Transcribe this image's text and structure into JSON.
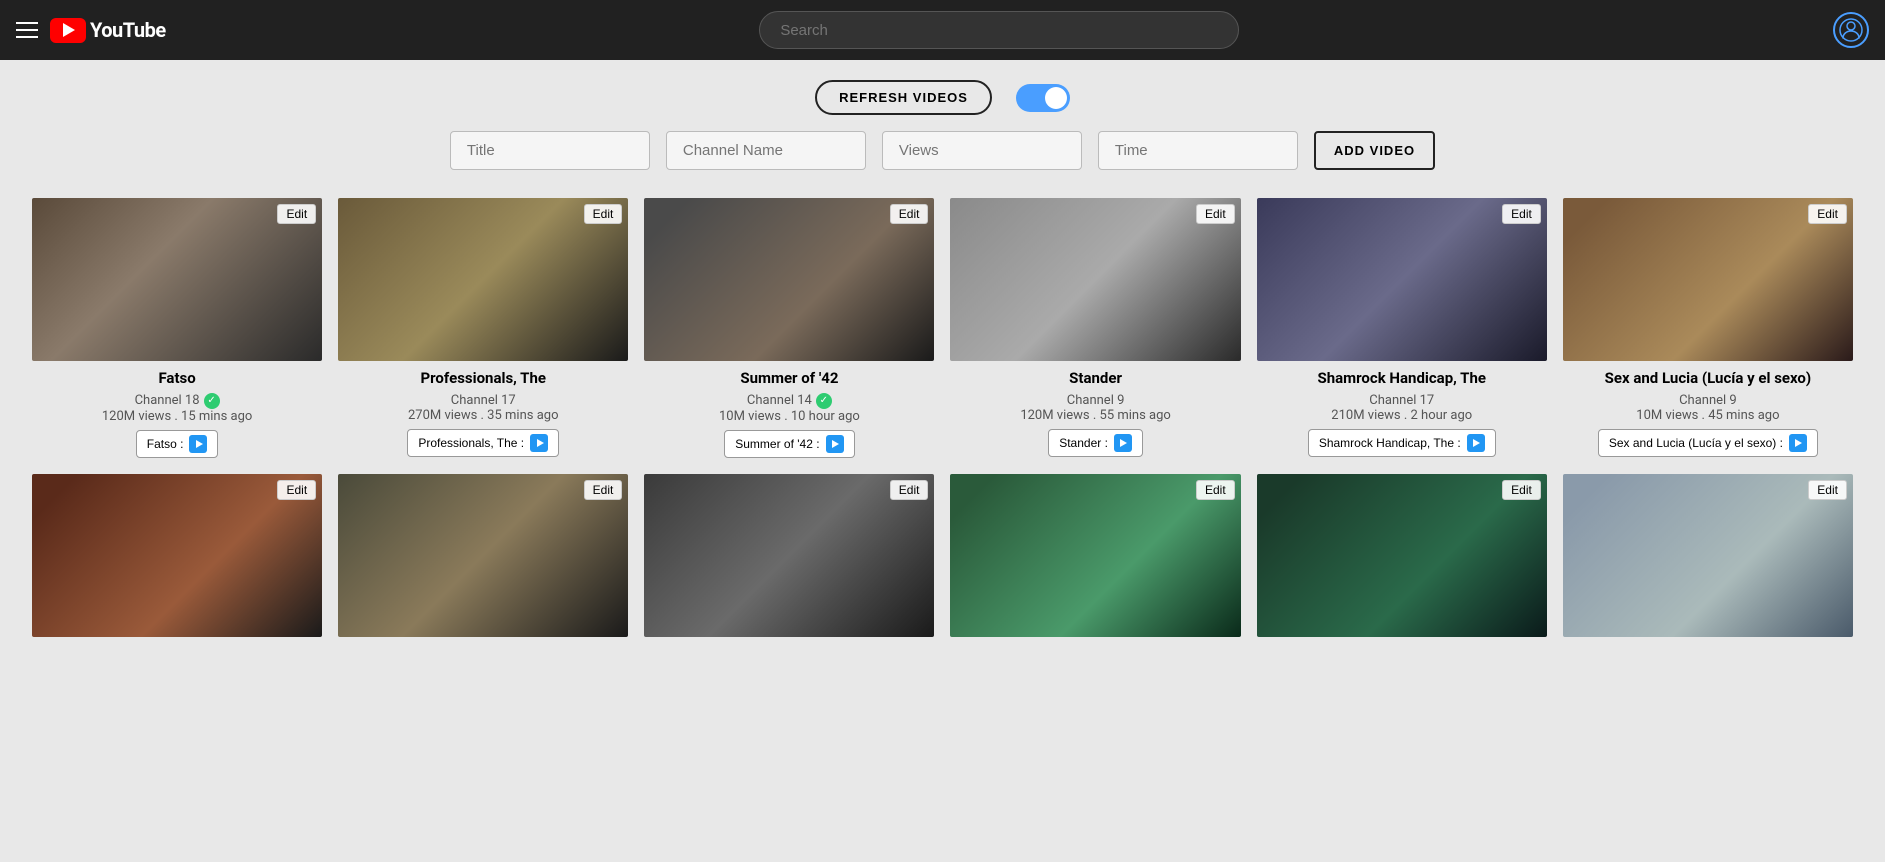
{
  "header": {
    "title": "YouTube",
    "search_placeholder": "Search",
    "hamburger_label": "Menu"
  },
  "controls": {
    "refresh_label": "REFRESH VIDEOS",
    "toggle_checked": true
  },
  "filters": {
    "title_placeholder": "Title",
    "channel_placeholder": "Channel Name",
    "views_placeholder": "Views",
    "time_placeholder": "Time",
    "add_button_label": "ADD VIDEO"
  },
  "videos": [
    {
      "id": 1,
      "title": "Fatso",
      "channel": "Channel 18",
      "verified": true,
      "views": "120M views",
      "time": "15 mins ago",
      "link_label": "Fatso :",
      "thumb_class": "thumb-1"
    },
    {
      "id": 2,
      "title": "Professionals, The",
      "channel": "Channel 17",
      "verified": false,
      "views": "270M views",
      "time": "35 mins ago",
      "link_label": "Professionals, The :",
      "thumb_class": "thumb-2"
    },
    {
      "id": 3,
      "title": "Summer of '42",
      "channel": "Channel 14",
      "verified": true,
      "views": "10M views",
      "time": "10 hour ago",
      "link_label": "Summer of '42 :",
      "thumb_class": "thumb-3"
    },
    {
      "id": 4,
      "title": "Stander",
      "channel": "Channel 9",
      "verified": false,
      "views": "120M views",
      "time": "55 mins ago",
      "link_label": "Stander :",
      "thumb_class": "thumb-4"
    },
    {
      "id": 5,
      "title": "Shamrock Handicap, The",
      "channel": "Channel 17",
      "verified": false,
      "views": "210M views",
      "time": "2 hour ago",
      "link_label": "Shamrock Handicap, The :",
      "thumb_class": "thumb-5"
    },
    {
      "id": 6,
      "title": "Sex and Lucia (Lucía y el sexo)",
      "channel": "Channel 9",
      "verified": false,
      "views": "10M views",
      "time": "45 mins ago",
      "link_label": "Sex and Lucia (Lucía y el sexo) :",
      "thumb_class": "thumb-6"
    },
    {
      "id": 7,
      "title": "",
      "channel": "",
      "verified": false,
      "views": "",
      "time": "",
      "link_label": "",
      "thumb_class": "thumb-7"
    },
    {
      "id": 8,
      "title": "",
      "channel": "",
      "verified": false,
      "views": "",
      "time": "",
      "link_label": "",
      "thumb_class": "thumb-8"
    },
    {
      "id": 9,
      "title": "",
      "channel": "",
      "verified": false,
      "views": "",
      "time": "",
      "link_label": "",
      "thumb_class": "thumb-9"
    },
    {
      "id": 10,
      "title": "",
      "channel": "",
      "verified": false,
      "views": "",
      "time": "",
      "link_label": "",
      "thumb_class": "thumb-10"
    },
    {
      "id": 11,
      "title": "",
      "channel": "",
      "verified": false,
      "views": "",
      "time": "",
      "link_label": "",
      "thumb_class": "thumb-11"
    },
    {
      "id": 12,
      "title": "",
      "channel": "",
      "verified": false,
      "views": "",
      "time": "",
      "link_label": "",
      "thumb_class": "thumb-12"
    }
  ],
  "edit_label": "Edit"
}
